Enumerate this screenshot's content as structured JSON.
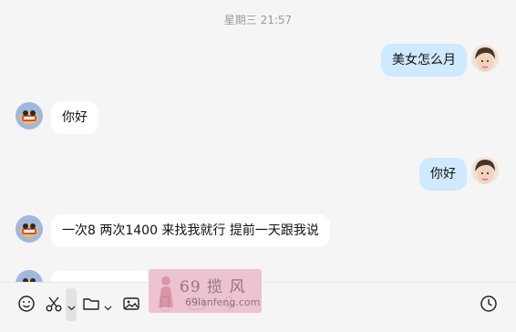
{
  "chat": {
    "timestamp": "星期三 21:57",
    "messages": [
      {
        "from": "me",
        "text": "美女怎么月"
      },
      {
        "from": "other",
        "text": "你好"
      },
      {
        "from": "me",
        "text": "你好"
      },
      {
        "from": "other",
        "text": "一次8 两次1400 来找我就行 提前一天跟我说"
      }
    ]
  },
  "toolbar": {
    "icons": [
      "emoji-icon",
      "scissors-icon",
      "folder-icon",
      "image-icon",
      "phone-icon",
      "mail-icon",
      "microphone-icon",
      "clock-icon"
    ]
  },
  "watermark": {
    "title": "69 揽 风",
    "url": "69lanfeng.com"
  }
}
